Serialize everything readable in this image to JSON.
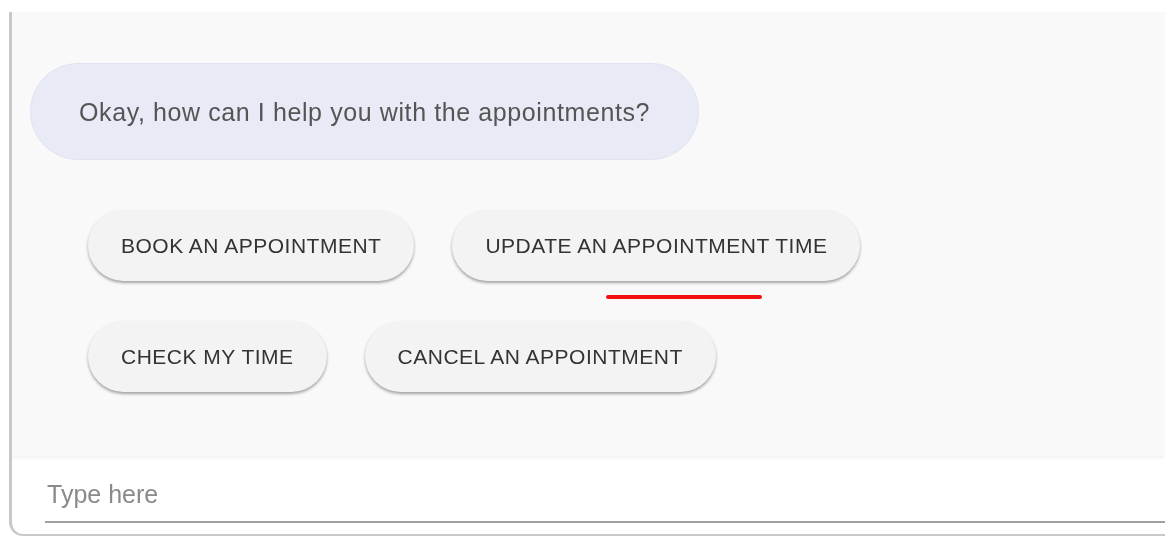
{
  "messages": [
    {
      "text": "Okay, how can I help you with the appointments?"
    }
  ],
  "suggestion_rows": [
    [
      {
        "label": "BOOK AN APPOINTMENT",
        "underlined": false
      },
      {
        "label": "UPDATE AN APPOINTMENT TIME",
        "underlined": true
      }
    ],
    [
      {
        "label": "CHECK MY TIME",
        "underlined": false
      },
      {
        "label": "CANCEL AN APPOINTMENT",
        "underlined": false
      }
    ]
  ],
  "input": {
    "placeholder": "Type here"
  }
}
